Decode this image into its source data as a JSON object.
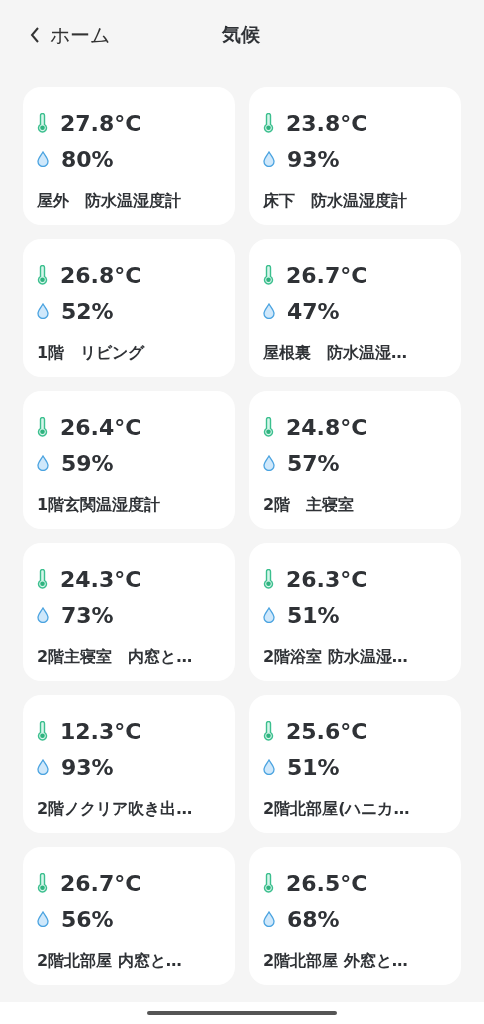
{
  "header": {
    "back_label": "ホーム",
    "title": "気候"
  },
  "sensors": [
    {
      "temperature": "27.8°C",
      "humidity": "80%",
      "name": "屋外　防水温湿度計"
    },
    {
      "temperature": "23.8°C",
      "humidity": "93%",
      "name": "床下　防水温湿度計"
    },
    {
      "temperature": "26.8°C",
      "humidity": "52%",
      "name": "1階　リビング"
    },
    {
      "temperature": "26.7°C",
      "humidity": "47%",
      "name": "屋根裏　防水温湿…"
    },
    {
      "temperature": "26.4°C",
      "humidity": "59%",
      "name": "1階玄関温湿度計"
    },
    {
      "temperature": "24.8°C",
      "humidity": "57%",
      "name": "2階　主寝室"
    },
    {
      "temperature": "24.3°C",
      "humidity": "73%",
      "name": "2階主寝室　内窓と…"
    },
    {
      "temperature": "26.3°C",
      "humidity": "51%",
      "name": "2階浴室 防水温湿…"
    },
    {
      "temperature": "12.3°C",
      "humidity": "93%",
      "name": "2階ノクリア吹き出…"
    },
    {
      "temperature": "25.6°C",
      "humidity": "51%",
      "name": "2階北部屋(ハニカ…"
    },
    {
      "temperature": "26.7°C",
      "humidity": "56%",
      "name": "2階北部屋 内窓と…"
    },
    {
      "temperature": "26.5°C",
      "humidity": "68%",
      "name": "2階北部屋 外窓と…"
    }
  ]
}
